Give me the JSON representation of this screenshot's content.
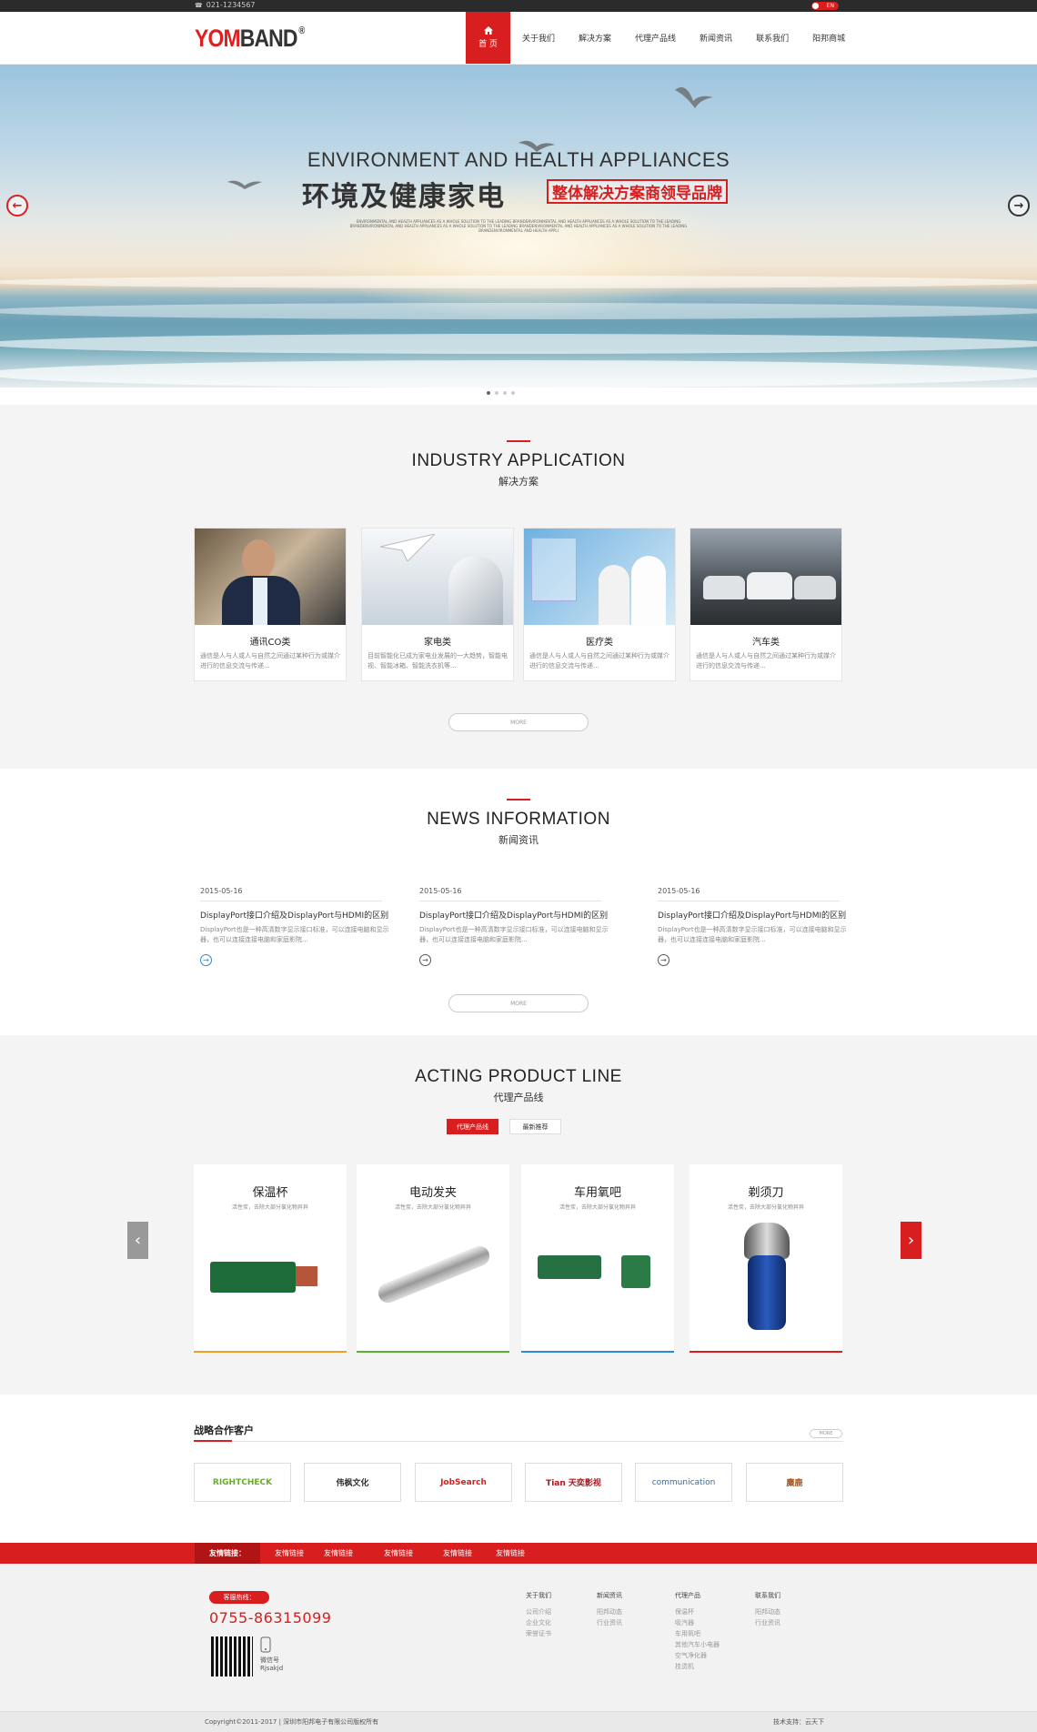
{
  "topbar": {
    "phone": "021-1234567",
    "lang": "EN"
  },
  "header": {
    "logo_main": "YOM",
    "logo_band": "BAND",
    "logo_mark": "®"
  },
  "nav": [
    "首 页",
    "关于我们",
    "解决方案",
    "代理产品线",
    "新闻资讯",
    "联系我们",
    "阳邦商城"
  ],
  "banner": {
    "title_en": "ENVIRONMENT AND HEALTH APPLIANCES",
    "title_cn": "环境及健康家电",
    "tag": "整体解决方案商领导品牌",
    "small_text": "ENVIRONMENTAL AND HEALTH APPLIANCES AS A WHOLE SOLUTION TO THE LEADING BRANDENVIRONMENTAL AND HEALTH APPLIANCES AS A WHOLE SOLUTION TO THE LEADING BRANDENVIRONMENTAL AND HEALTH APPLIANCES AS A WHOLE SOLUTION TO THE LEADING BRANDENVIRONMENTAL AND HEALTH APPLIANCES AS A WHOLE SOLUTION TO THE LEADING BRANDENVIRONMENTAL AND HEALTH APPLI"
  },
  "industry": {
    "title_en": "INDUSTRY APPLICATION",
    "title_cn": "解决方案",
    "more": "MORE",
    "cards": [
      {
        "title": "通讯CO类",
        "desc": "通信是人与人或人与自然之间通过某种行为或媒介进行的信息交流与传递..."
      },
      {
        "title": "家电类",
        "desc": "目前智能化已成为家电业发展的一大趋势，智能电视、智能冰箱、智能洗衣机等..."
      },
      {
        "title": "医疗类",
        "desc": "通信是人与人或人与自然之间通过某种行为或媒介进行的信息交流与传递..."
      },
      {
        "title": "汽车类",
        "desc": "通信是人与人或人与自然之间通过某种行为或媒介进行的信息交流与传递..."
      }
    ]
  },
  "news": {
    "title_en": "NEWS INFORMATION",
    "title_cn": "新闻资讯",
    "more": "MORE",
    "items": [
      {
        "date": "2015-05-16",
        "title": "DisplayPort接口介绍及DisplayPort与HDMI的区别",
        "desc": "DisplayPort也是一种高清数字显示接口标准，可以连接电脑和显示器，也可以连接连接电脑和家庭影院..."
      },
      {
        "date": "2015-05-16",
        "title": "DisplayPort接口介绍及DisplayPort与HDMI的区别",
        "desc": "DisplayPort也是一种高清数字显示接口标准，可以连接电脑和显示器，也可以连接连接电脑和家庭影院..."
      },
      {
        "date": "2015-05-16",
        "title": "DisplayPort接口介绍及DisplayPort与HDMI的区别",
        "desc": "DisplayPort也是一种高清数字显示接口标准，可以连接电脑和显示器，也可以连接连接电脑和家庭影院..."
      }
    ]
  },
  "products": {
    "title_en": "ACTING PRODUCT LINE",
    "title_cn": "代理产品线",
    "tabs": [
      "代理产品线",
      "最新推荐"
    ],
    "items": [
      {
        "title": "保温杯",
        "sub": "活性炭，去除大部分氯化物异异",
        "color": "#f0a020"
      },
      {
        "title": "电动发夹",
        "sub": "活性炭，去除大部分氯化物异异",
        "color": "#5ab030"
      },
      {
        "title": "车用氧吧",
        "sub": "活性炭，去除大部分氯化物异异",
        "color": "#2a8ad8"
      },
      {
        "title": "剃须刀",
        "sub": "活性炭，去除大部分氯化物异异",
        "color": "#d81e1e"
      }
    ]
  },
  "partners": {
    "title": "战略合作客户",
    "more": "MORE",
    "logos": [
      "RIGHTCHECK",
      "伟枫文化",
      "JobSearch",
      "Tian 天奕影视",
      "communication",
      "麋鹿"
    ]
  },
  "links": {
    "label": "友情链接：",
    "items": [
      "友情链接",
      "友情链接",
      "友情链接",
      "友情链接",
      "友情链接"
    ]
  },
  "footer": {
    "hotline_label": "客服热线：",
    "tel": "0755-86315099",
    "wechat_label": "微信号",
    "wechat_id": "Rjsakjd",
    "cols": [
      {
        "h": "关于我们",
        "items": [
          "公司介绍",
          "企业文化",
          "荣誉证书"
        ]
      },
      {
        "h": "新闻资讯",
        "items": [
          "阳邦动态",
          "行业资讯"
        ]
      },
      {
        "h": "代理产品",
        "items": [
          "保温杯",
          "吸汽器",
          "车用氧吧",
          "其他汽车小电器",
          "空气净化器",
          "挂烫机"
        ]
      },
      {
        "h": "联系我们",
        "items": [
          "阳邦动态",
          "行业资讯"
        ]
      }
    ],
    "copyright": "Copyright©2011-2017 | 深圳市阳邦电子有限公司版权所有",
    "support": "技术支持：云天下"
  }
}
